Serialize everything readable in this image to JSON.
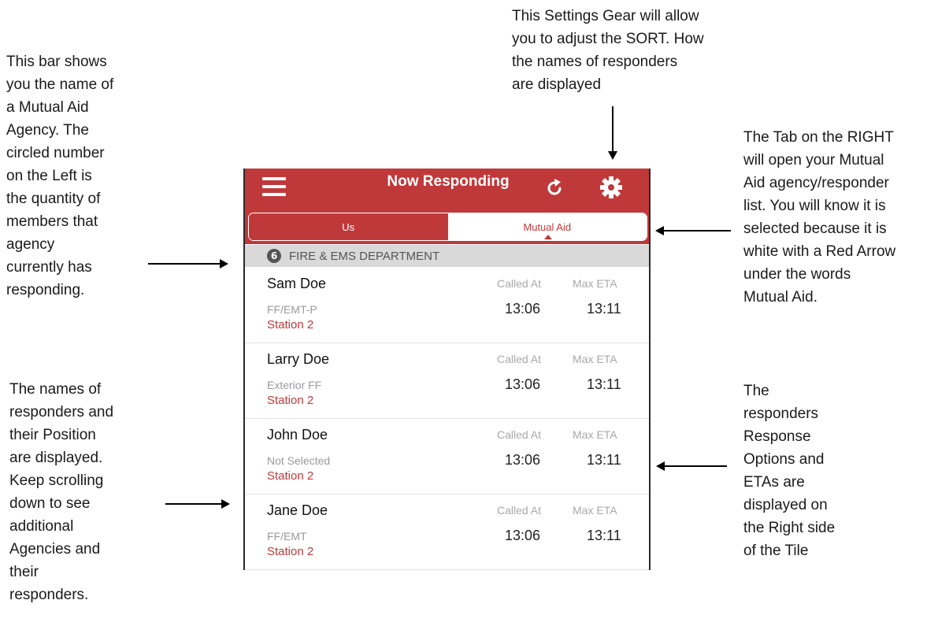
{
  "annotations": {
    "left_top": "This bar shows\nyou the name of\na Mutual Aid\nAgency.  The\ncircled number\non the Left is\nthe quantity of\nmembers that\nagency\ncurrently has\nresponding.",
    "left_bottom": "The names of\nresponders and\ntheir Position\nare displayed.\nKeep scrolling\ndown to see\nadditional\nAgencies and\ntheir\nresponders.",
    "top": "This Settings Gear will allow\nyou to adjust the SORT. How\nthe names of responders\nare displayed",
    "right_top": "The Tab on the RIGHT\nwill open your Mutual\nAid agency/responder\nlist. You will know it is\nselected because it is\nwhite with a Red Arrow\nunder the words\nMutual Aid.",
    "right_bottom": "The\nresponders\nResponse\nOptions and\nETAs are\ndisplayed on\nthe Right side\nof the Tile"
  },
  "header": {
    "title": "Now Responding",
    "icons": [
      "menu-icon",
      "refresh-icon",
      "gear-icon"
    ]
  },
  "tabs": [
    {
      "label": "Us",
      "selected": false
    },
    {
      "label": "Mutual Aid",
      "selected": true
    }
  ],
  "agency": {
    "count": "6",
    "name": "FIRE & EMS DEPARTMENT"
  },
  "responders": [
    {
      "name": "Sam Doe",
      "position": "FF/EMT-P",
      "station": "Station 2",
      "called_label": "Called At",
      "eta_label": "Max ETA",
      "called_at": "13:06",
      "max_eta": "13:11"
    },
    {
      "name": "Larry Doe",
      "position": "Exterior FF",
      "station": "Station 2",
      "called_label": "Called At",
      "eta_label": "Max ETA",
      "called_at": "13:06",
      "max_eta": "13:11"
    },
    {
      "name": "John Doe",
      "position": "Not Selected",
      "station": "Station 2",
      "called_label": "Called At",
      "eta_label": "Max ETA",
      "called_at": "13:06",
      "max_eta": "13:11"
    },
    {
      "name": "Jane Doe",
      "position": "FF/EMT",
      "station": "Station 2",
      "called_label": "Called At",
      "eta_label": "Max ETA",
      "called_at": "13:06",
      "max_eta": "13:11"
    }
  ],
  "colors": {
    "brand": "#c0393a",
    "agency_bar": "#d9d9d9"
  }
}
